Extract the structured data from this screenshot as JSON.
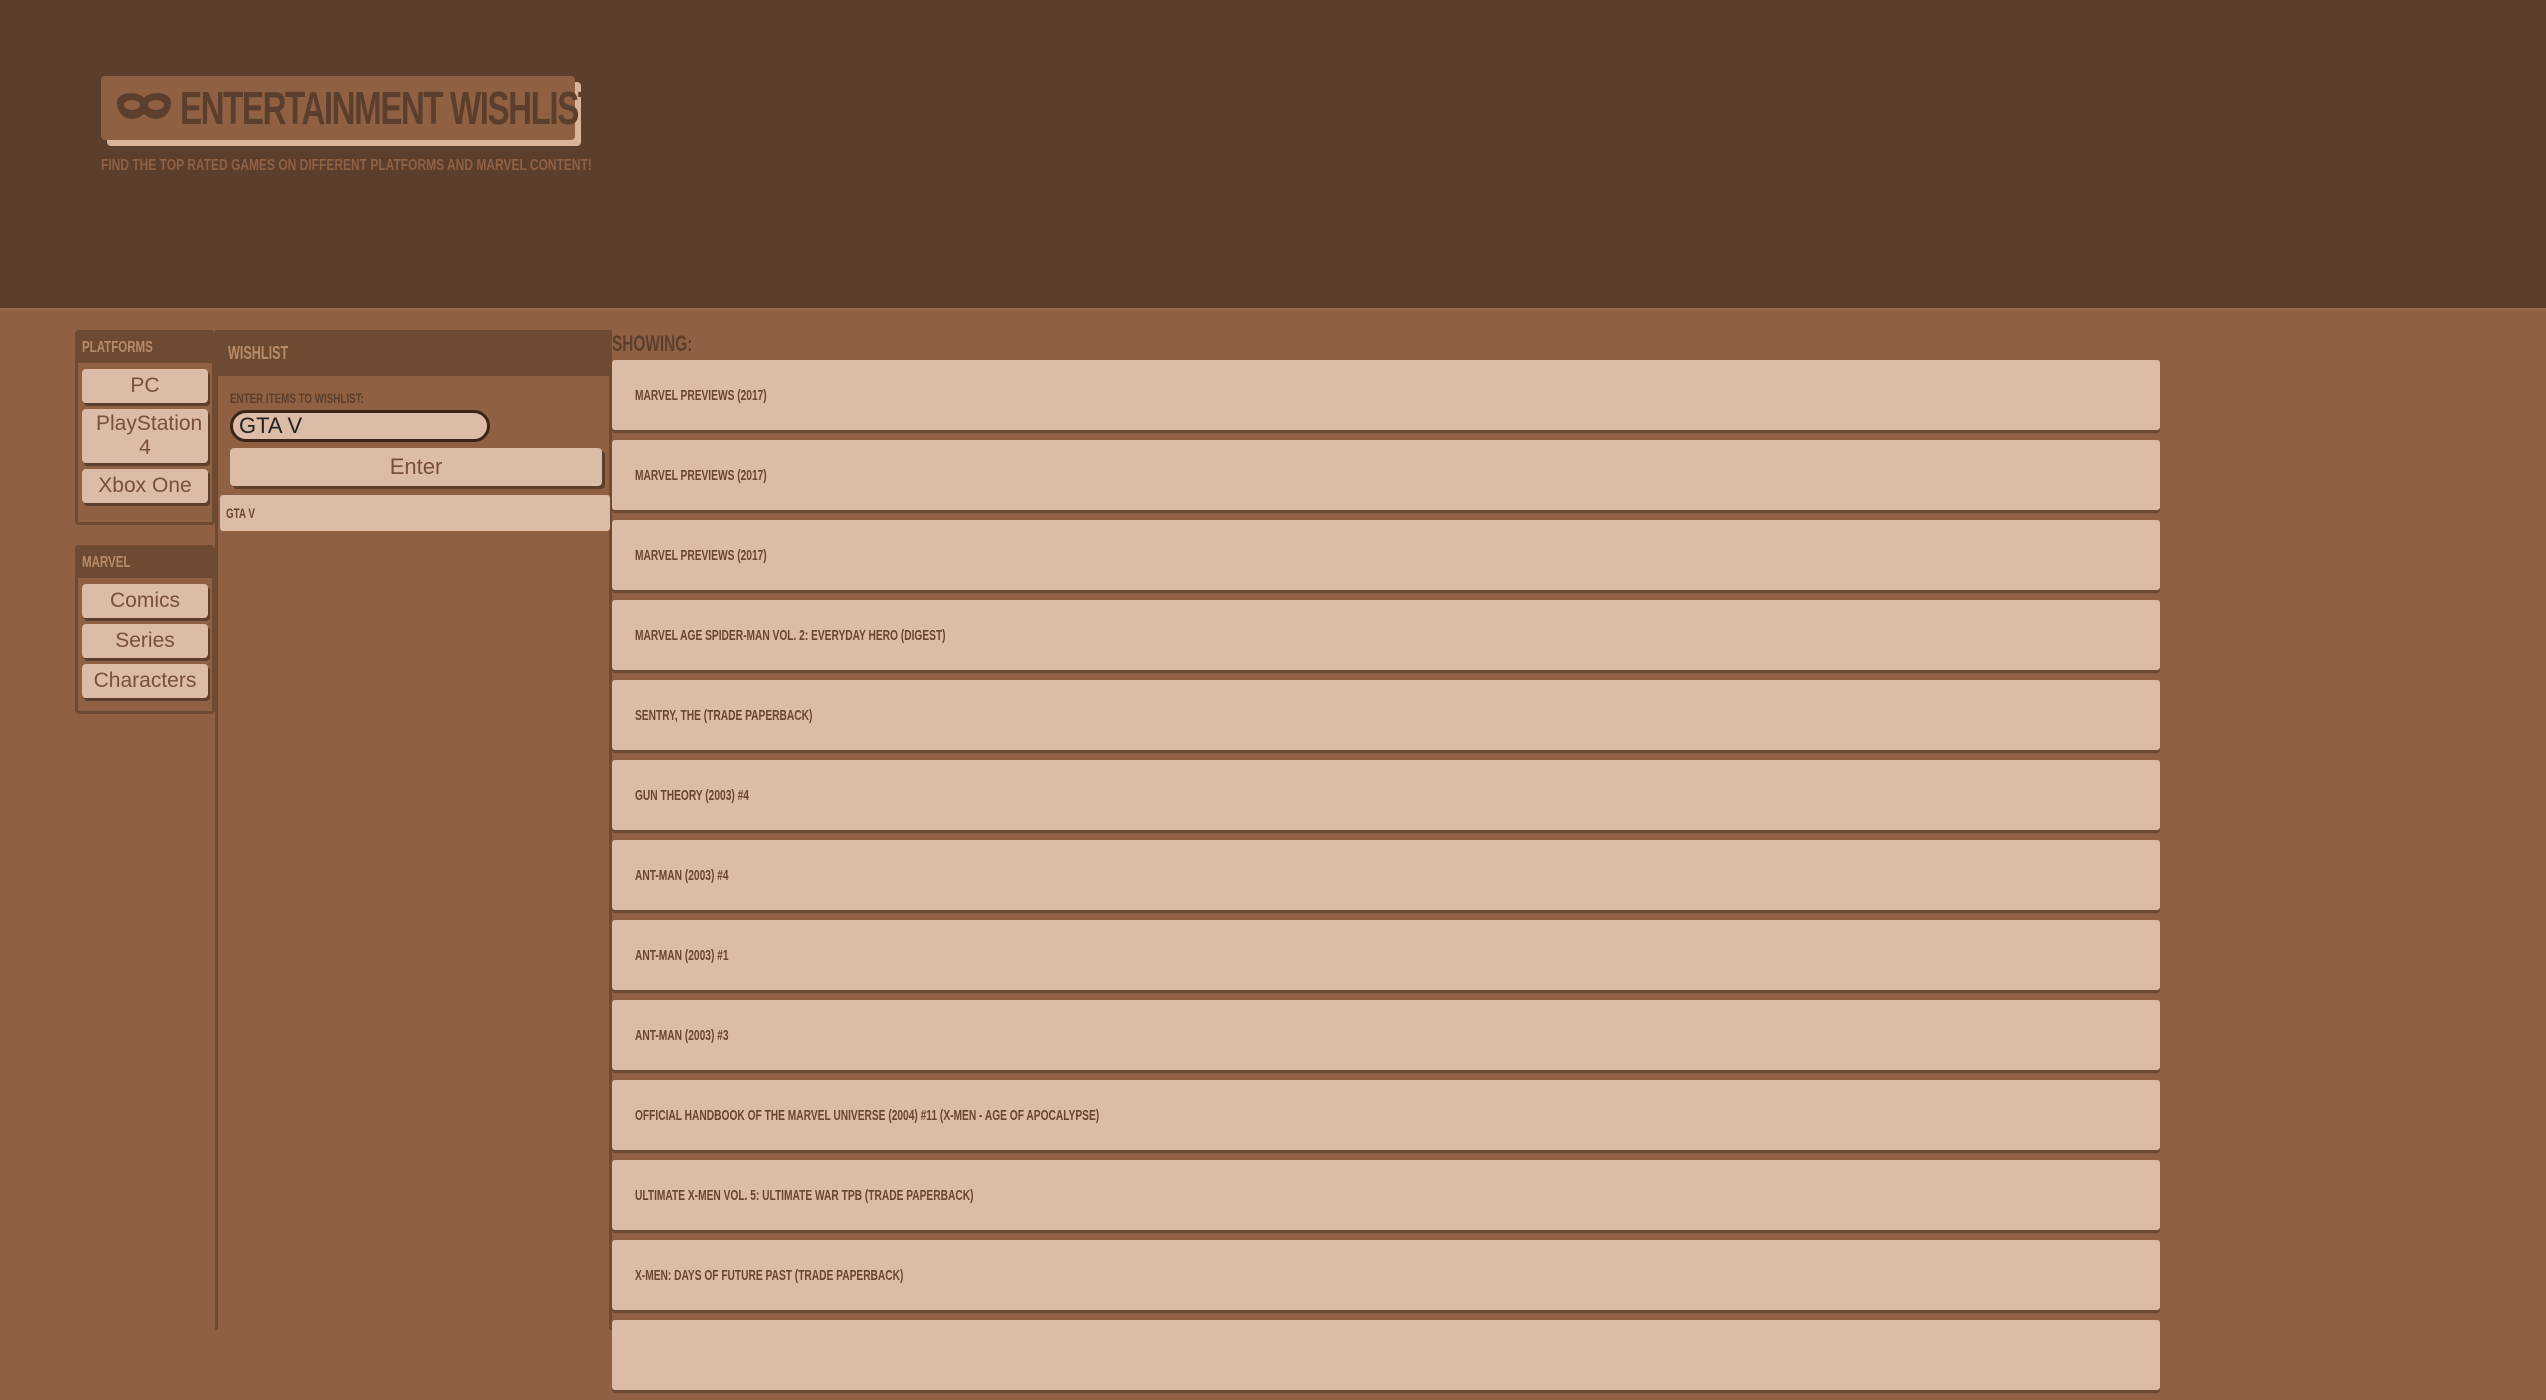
{
  "header": {
    "title": "ENTERTAINMENT WISHLIST",
    "tagline": "FIND THE TOP RATED GAMES ON DIFFERENT PLATFORMS AND MARVEL CONTENT!",
    "logo_icon": "mask-icon"
  },
  "platforms": {
    "heading": "PLATFORMS",
    "items": [
      "PC",
      "PlayStation 4",
      "Xbox One"
    ]
  },
  "marvel": {
    "heading": "MARVEL",
    "items": [
      "Comics",
      "Series",
      "Characters"
    ]
  },
  "wishlist": {
    "heading": "WISHLIST",
    "input_label": "ENTER ITEMS TO WISHLIST:",
    "input_value": "GTA V",
    "enter_label": "Enter",
    "items": [
      "GTA V"
    ]
  },
  "results": {
    "heading": "SHOWING:",
    "items": [
      "MARVEL PREVIEWS (2017)",
      "MARVEL PREVIEWS (2017)",
      "MARVEL PREVIEWS (2017)",
      "MARVEL AGE SPIDER-MAN VOL. 2: EVERYDAY HERO (DIGEST)",
      "SENTRY, THE (TRADE PAPERBACK)",
      "GUN THEORY (2003) #4",
      "ANT-MAN (2003) #4",
      "ANT-MAN (2003) #1",
      "ANT-MAN (2003) #3",
      "OFFICIAL HANDBOOK OF THE MARVEL UNIVERSE (2004) #11 (X-MEN - AGE OF APOCALYPSE)",
      "ULTIMATE X-MEN VOL. 5: ULTIMATE WAR TPB (TRADE PAPERBACK)",
      "X-MEN: DAYS OF FUTURE PAST (TRADE PAPERBACK)",
      ""
    ]
  },
  "colors": {
    "header_bg": "#5c3e2d",
    "page_bg": "#8f6142",
    "card_bg": "#dcbca6",
    "text": "#6b4530"
  }
}
